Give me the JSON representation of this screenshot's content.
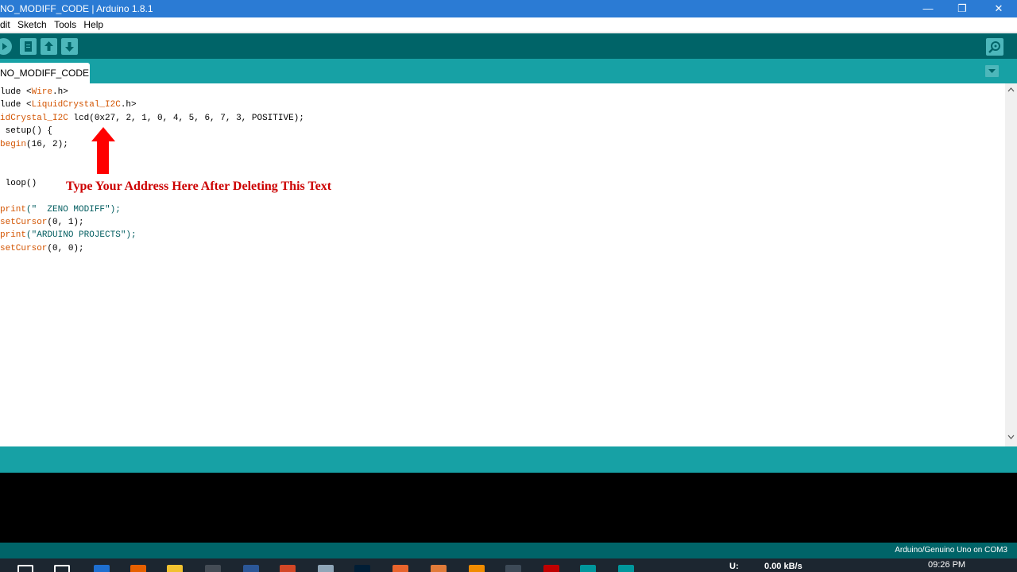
{
  "window": {
    "title": "NO_MODIFF_CODE | Arduino 1.8.1",
    "minimize_glyph": "—",
    "restore_glyph": "❐",
    "close_glyph": "✕"
  },
  "menu": {
    "items": [
      "dit",
      "Sketch",
      "Tools",
      "Help"
    ]
  },
  "toolbar": {
    "icons": [
      "upload-arrow-icon",
      "new-file-icon",
      "open-icon",
      "save-icon",
      "serial-monitor-icon"
    ]
  },
  "tabs": {
    "active_label": "NO_MODIFF_CODE",
    "menu_glyph": "▼"
  },
  "code": {
    "lines": [
      {
        "parts": [
          {
            "t": "lude <",
            "c": ""
          },
          {
            "t": "Wire",
            "c": "kw-orange"
          },
          {
            "t": ".h>",
            "c": ""
          }
        ]
      },
      {
        "parts": [
          {
            "t": "lude <",
            "c": ""
          },
          {
            "t": "LiquidCrystal_I2C",
            "c": "kw-orange"
          },
          {
            "t": ".h>",
            "c": ""
          }
        ]
      },
      {
        "parts": [
          {
            "t": "idCrystal_I2C",
            "c": "kw-orange"
          },
          {
            "t": " lcd(0x27, 2, 1, 0, 4, 5, 6, 7, 3, POSITIVE);",
            "c": ""
          }
        ]
      },
      {
        "parts": [
          {
            "t": " setup() {",
            "c": ""
          }
        ]
      },
      {
        "parts": [
          {
            "t": "begin",
            "c": "kw-orange"
          },
          {
            "t": "(16, 2);",
            "c": ""
          }
        ]
      },
      {
        "parts": [
          {
            "t": "",
            "c": ""
          }
        ]
      },
      {
        "parts": [
          {
            "t": "",
            "c": ""
          }
        ]
      },
      {
        "parts": [
          {
            "t": " loop()",
            "c": ""
          }
        ]
      },
      {
        "parts": [
          {
            "t": "",
            "c": ""
          }
        ]
      },
      {
        "parts": [
          {
            "t": "print",
            "c": "kw-orange"
          },
          {
            "t": "(\"  ZENO MODIFF\");",
            "c": "str"
          }
        ]
      },
      {
        "parts": [
          {
            "t": "setCursor",
            "c": "kw-orange"
          },
          {
            "t": "(0, 1);",
            "c": ""
          }
        ]
      },
      {
        "parts": [
          {
            "t": "print",
            "c": "kw-orange"
          },
          {
            "t": "(\"ARDUINO PROJECTS\");",
            "c": "str"
          }
        ]
      },
      {
        "parts": [
          {
            "t": "setCursor",
            "c": "kw-orange"
          },
          {
            "t": "(0, 0);",
            "c": ""
          }
        ]
      }
    ]
  },
  "annotation": {
    "text": "Type Your Address Here After Deleting This Text",
    "color": "#cc0000"
  },
  "status": {
    "board": "Arduino/Genuino Uno on COM3"
  },
  "taskbar": {
    "net_label": "U:",
    "net_speed": "0.00 kB/s",
    "time": "09:26 PM",
    "icons": [
      "search-icon",
      "task-view-icon",
      "edge-icon",
      "firefox-icon",
      "explorer-icon",
      "store-icon",
      "word-icon",
      "powerpoint-icon",
      "app-icon",
      "photoshop-icon",
      "app2-icon",
      "app3-icon",
      "vlc-icon",
      "app4-icon",
      "filezilla-icon",
      "arduino-icon",
      "arduino-active-icon"
    ]
  },
  "colors": {
    "toolbar": "#006468",
    "tabbar": "#17a1a5",
    "titlebar": "#2b7bd4"
  }
}
